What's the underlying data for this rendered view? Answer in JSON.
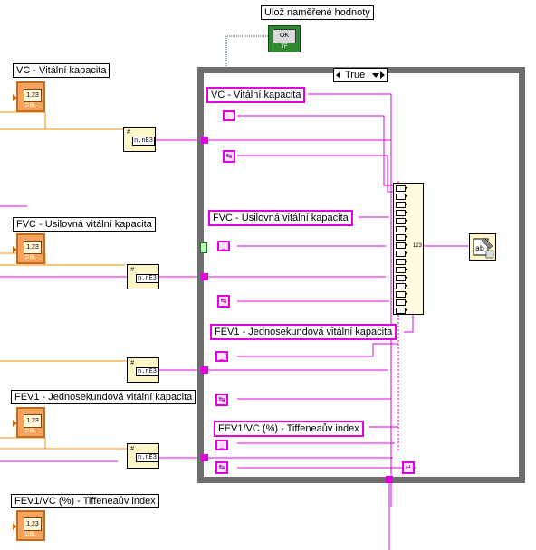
{
  "button_label": "Ulož naměřené hodnoty",
  "button_face": "OK",
  "button_type": "TF",
  "case_selector": "True",
  "terminal_type": "DBL",
  "terminal_value": "1.23",
  "converter_top": "#",
  "converter_mid": "n.nE3",
  "bundle_bottom": "123",
  "controls": [
    {
      "label": "VC - Vitální kapacita"
    },
    {
      "label": "FVC - Usilovná vitální kapacita"
    },
    {
      "label": "FEV1 - Jednosekundová vitální kapacita"
    },
    {
      "label": "FEV1/VC (%) - Tiffeneaův index"
    }
  ],
  "case_labels": [
    {
      "label": "VC - Vitální kapacita"
    },
    {
      "label": "FVC - Usilovná vitální kapacita"
    },
    {
      "label": "FEV1 - Jednosekundová vitální kapacita"
    },
    {
      "label": "FEV1/VC (%) - Tiffeneaův index"
    }
  ],
  "colors": {
    "string_wire": "#e000e0",
    "numeric_wire": "#f48c00",
    "boolean_wire": "#1b7a1b",
    "case_frame": "#6e6e6e",
    "dbl_terminal": "#f4a460",
    "bool_terminal": "#2f8a2f"
  }
}
